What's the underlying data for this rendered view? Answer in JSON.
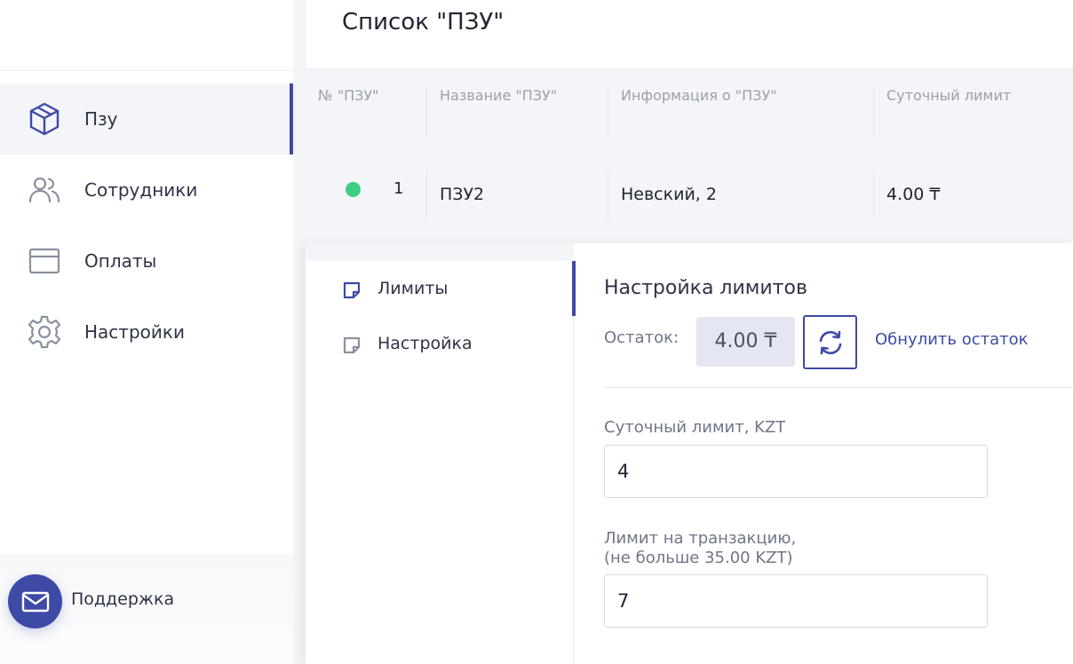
{
  "sidebar": {
    "items": [
      {
        "label": "Пзу",
        "icon": "box-icon",
        "active": true
      },
      {
        "label": "Сотрудники",
        "icon": "users-icon",
        "active": false
      },
      {
        "label": "Оплаты",
        "icon": "credit-card-icon",
        "active": false
      },
      {
        "label": "Настройки",
        "icon": "gear-icon",
        "active": false
      }
    ],
    "support": {
      "label": "Поддержка",
      "icon": "mail-icon"
    }
  },
  "header": {
    "title": "Список \"ПЗУ\""
  },
  "table": {
    "columns": [
      "№ \"ПЗУ\"",
      "Название \"ПЗУ\"",
      "Информация о \"ПЗУ\"",
      "Суточный лимит"
    ],
    "rows": [
      {
        "status": "online",
        "number": "1",
        "name": "ПЗУ2",
        "info": "Невский, 2",
        "daily_limit": "4.00 ₸"
      }
    ]
  },
  "detail": {
    "tabs": [
      {
        "label": "Лимиты",
        "icon": "note-icon",
        "active": true
      },
      {
        "label": "Настройка",
        "icon": "note-icon",
        "active": false
      }
    ],
    "title": "Настройка лимитов",
    "balance_label": "Остаток:",
    "balance_value": "4.00 ₸",
    "reset_label": "Обнулить остаток",
    "fields": [
      {
        "label": "Суточный лимит, KZT",
        "value": "4"
      },
      {
        "label_line1": "Лимит на транзакцию,",
        "label_line2": "(не больше 35.00 KZT)",
        "value": "7"
      }
    ]
  },
  "colors": {
    "accent": "#3d4aa6",
    "status_online": "#3ecf83",
    "background": "#f4f5f8"
  }
}
